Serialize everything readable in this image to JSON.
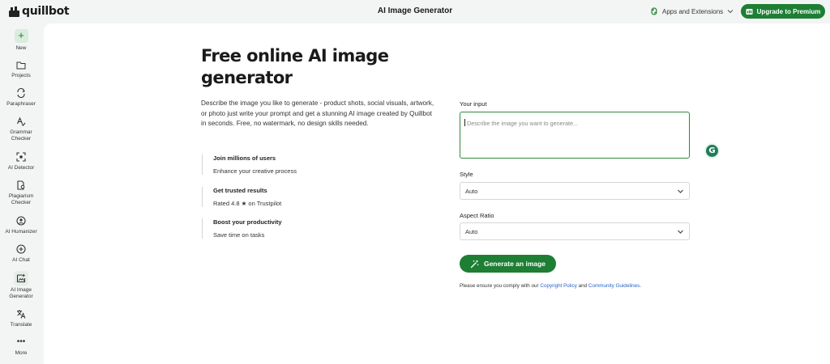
{
  "app": {
    "logo_text": "quillbot",
    "page_title": "AI Image Generator"
  },
  "topbar": {
    "apps_label": "Apps and Extensions",
    "upgrade_label": "Upgrade to Premium"
  },
  "sidebar": {
    "items": [
      {
        "label": "New",
        "icon": "plus-icon"
      },
      {
        "label": "Projects",
        "icon": "folder-icon"
      },
      {
        "label": "Paraphraser",
        "icon": "paraphraser-icon"
      },
      {
        "label": "Grammar Checker",
        "icon": "grammar-icon"
      },
      {
        "label": "AI Detector",
        "icon": "ai-detector-icon"
      },
      {
        "label": "Plagiarism Checker",
        "icon": "plagiarism-icon"
      },
      {
        "label": "AI Humanizer",
        "icon": "humanizer-icon"
      },
      {
        "label": "AI Chat",
        "icon": "chat-icon"
      },
      {
        "label": "AI Image Generator",
        "icon": "image-generator-icon"
      },
      {
        "label": "Translate",
        "icon": "translate-icon"
      },
      {
        "label": "More",
        "icon": "more-icon"
      }
    ]
  },
  "hero": {
    "title": "Free online AI image generator",
    "description": "Describe the image you like to generate - product shots, social visuals, artwork, or photo just write your prompt and get a stunning AI image created by Quillbot in seconds. Free, no watermark, no design skills needed."
  },
  "features": [
    {
      "title": "Join millions of users",
      "desc": "Enhance your creative process"
    },
    {
      "title": "Get trusted results",
      "desc": "Rated 4.8 ★ on Trustpilot"
    },
    {
      "title": "Boost your productivity",
      "desc": "Save time on tasks"
    }
  ],
  "form": {
    "input_label": "Your input",
    "input_placeholder": "Describe the image you want to generate...",
    "style_label": "Style",
    "style_value": "Auto",
    "ratio_label": "Aspect Ratio",
    "ratio_value": "Auto",
    "generate_label": "Generate an image",
    "grammarly_letter": "G"
  },
  "note": {
    "prefix": "Please ensure you comply with our ",
    "link1": "Copyright Policy",
    "middle": " and ",
    "link2": "Community Guidelines",
    "suffix": "."
  },
  "colors": {
    "brand_green": "#1e7e34",
    "link_blue": "#2a62c9",
    "page_bg": "#f3f5f4"
  }
}
